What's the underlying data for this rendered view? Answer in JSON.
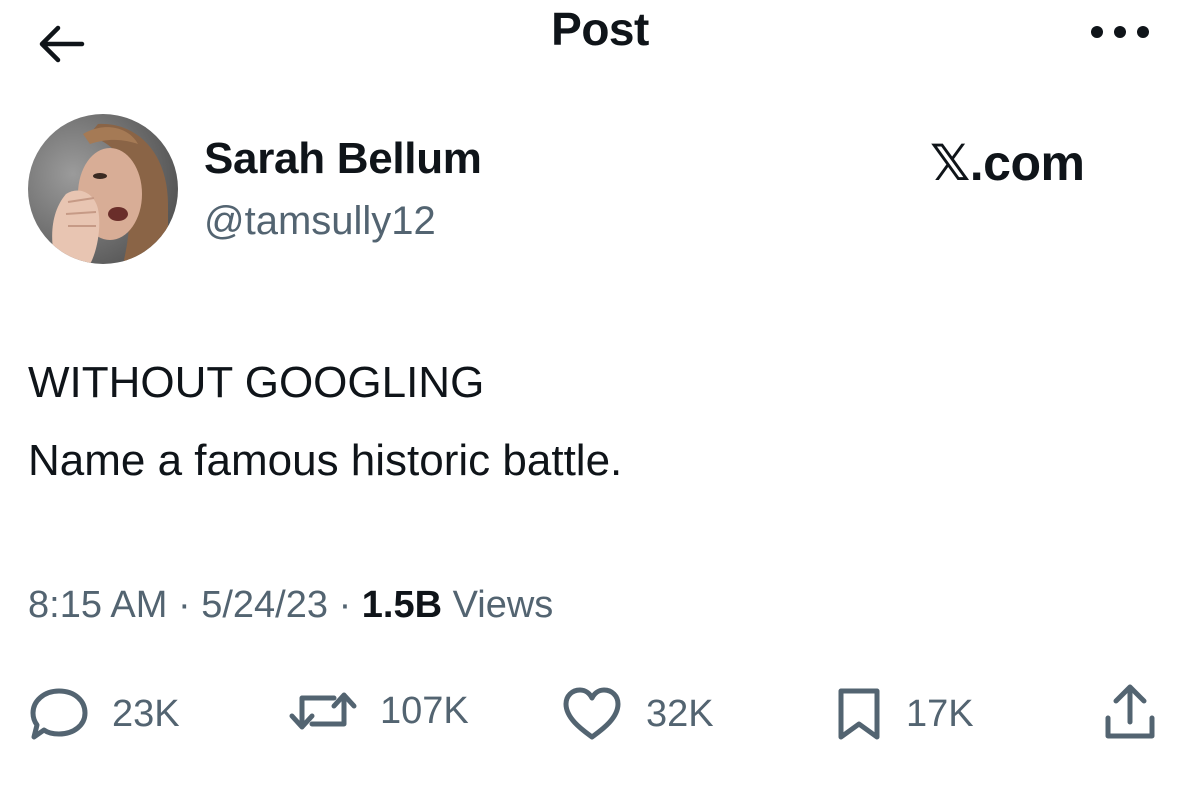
{
  "header": {
    "title": "Post",
    "back_icon": "arrow-left-icon",
    "more_icon": "more-horizontal-icon"
  },
  "author": {
    "display_name": "Sarah Bellum",
    "handle": "@tamsully12",
    "avatar_icon": "avatar"
  },
  "brand": "𝕏.com",
  "post": {
    "line1": "WITHOUT GOOGLING",
    "line2": "Name a famous historic battle."
  },
  "meta": {
    "time": "8:15 AM",
    "separator": "·",
    "date": "5/24/23",
    "views_count": "1.5B",
    "views_label": "Views"
  },
  "actions": {
    "reply": {
      "icon": "reply-icon",
      "count": "23K"
    },
    "repost": {
      "icon": "repost-icon",
      "count": "107K"
    },
    "like": {
      "icon": "heart-icon",
      "count": "32K"
    },
    "bookmark": {
      "icon": "bookmark-icon",
      "count": "17K"
    },
    "share": {
      "icon": "share-icon"
    }
  },
  "colors": {
    "text_primary": "#0f1419",
    "text_secondary": "#536471",
    "background": "#ffffff"
  }
}
